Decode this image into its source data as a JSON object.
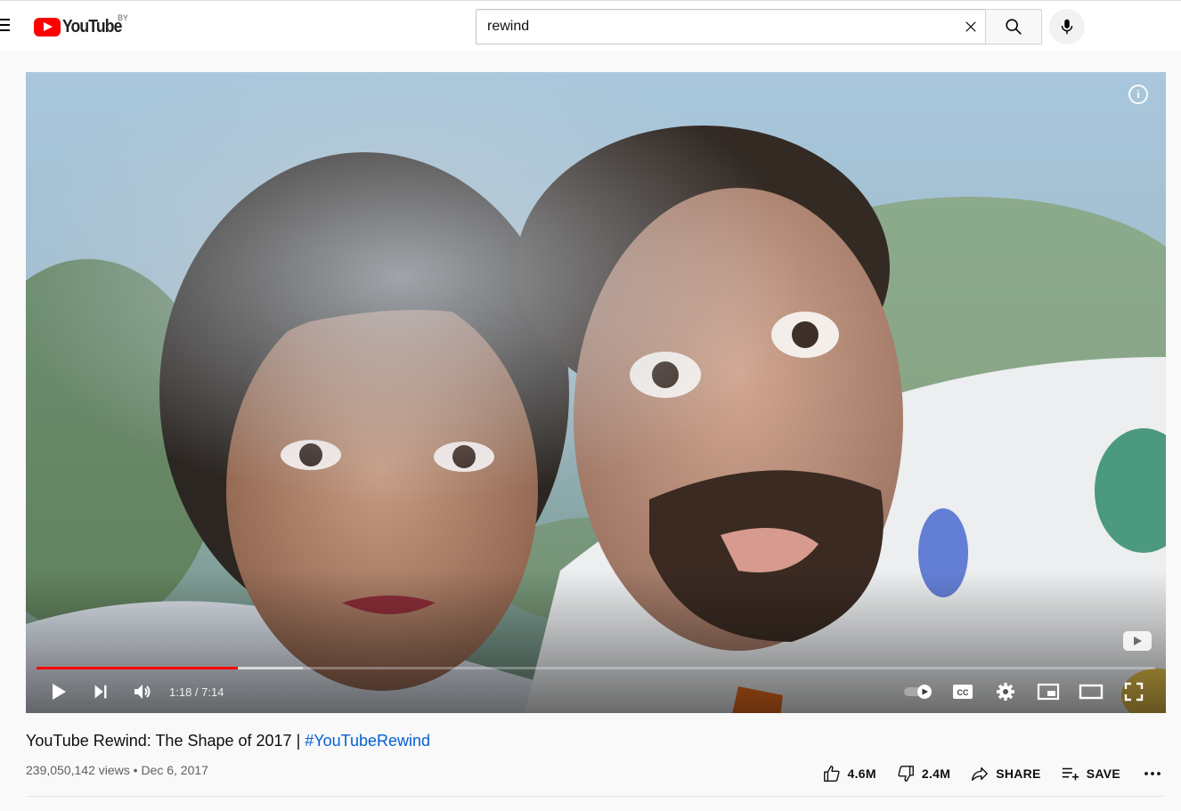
{
  "masthead": {
    "logo_text": "YouTube",
    "country_code": "BY",
    "search": {
      "value": "rewind",
      "placeholder": "Search"
    },
    "icons": {
      "menu": "menu-icon",
      "clear": "close-icon",
      "search": "search-icon",
      "mic": "microphone-icon"
    }
  },
  "player": {
    "current_time": "1:18",
    "duration": "7:14",
    "time_display": "1:18 / 7:14",
    "progress_played_fraction": 0.18,
    "progress_buffered_fraction": 0.238,
    "autoplay_on": true,
    "colors": {
      "progress_played": "#ff0000",
      "controls": "#ffffff"
    },
    "icons": [
      "play-icon",
      "next-icon",
      "volume-icon",
      "autoplay-toggle-icon",
      "captions-icon",
      "settings-gear-icon",
      "miniplayer-icon",
      "theater-mode-icon",
      "fullscreen-icon",
      "info-icon",
      "youtube-watermark-icon"
    ]
  },
  "video": {
    "title": "YouTube Rewind: The Shape of 2017 | ",
    "hashtag": "#YouTubeRewind",
    "views": "239,050,142 views",
    "separator": "•",
    "date": "Dec 6, 2017"
  },
  "actions": {
    "like_count": "4.6M",
    "dislike_count": "2.4M",
    "share_label": "SHARE",
    "save_label": "SAVE",
    "icons": [
      "thumbs-up-icon",
      "thumbs-down-icon",
      "share-arrow-icon",
      "add-to-playlist-icon",
      "more-horizontal-icon"
    ]
  }
}
